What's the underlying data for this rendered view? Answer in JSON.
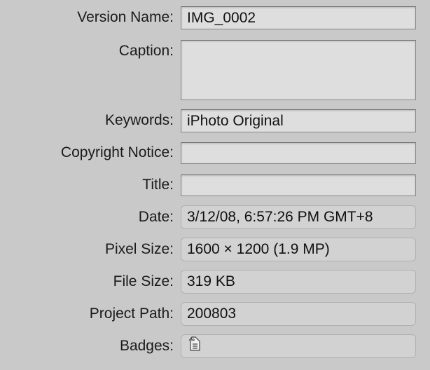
{
  "fields": {
    "version_name": {
      "label": "Version Name:",
      "value": "IMG_0002"
    },
    "caption": {
      "label": "Caption:",
      "value": ""
    },
    "keywords": {
      "label": "Keywords:",
      "value": "iPhoto Original"
    },
    "copyright": {
      "label": "Copyright Notice:",
      "value": ""
    },
    "title": {
      "label": "Title:",
      "value": ""
    },
    "date": {
      "label": "Date:",
      "value": "3/12/08, 6:57:26 PM GMT+8"
    },
    "pixel_size": {
      "label": "Pixel Size:",
      "value": "1600 × 1200 (1.9 MP)"
    },
    "file_size": {
      "label": "File Size:",
      "value": "319 KB"
    },
    "project_path": {
      "label": "Project Path:",
      "value": "200803"
    },
    "badges": {
      "label": "Badges:",
      "icons": [
        "tag-document-icon"
      ]
    }
  },
  "colors": {
    "background": "#c9c9c9",
    "field_fill": "#dcdcdc",
    "text": "#1a1a1a"
  }
}
